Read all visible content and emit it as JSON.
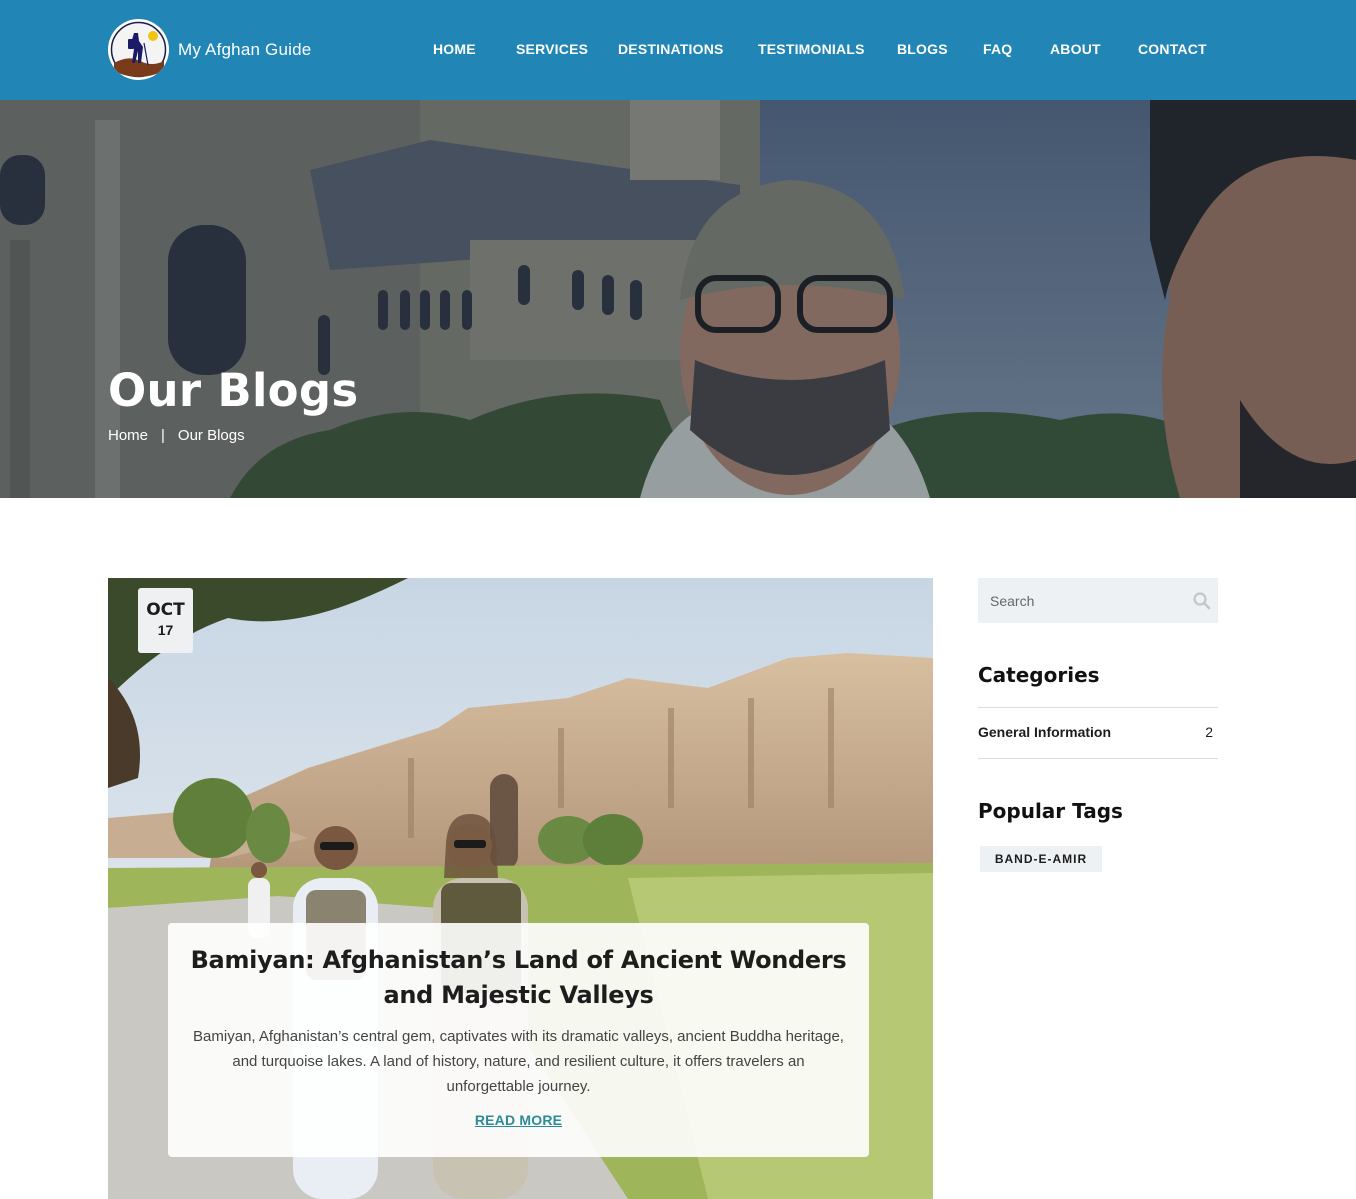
{
  "header": {
    "brand_name": "My Afghan Guide",
    "nav": [
      {
        "label": "HOME"
      },
      {
        "label": "SERVICES"
      },
      {
        "label": "DESTINATIONS"
      },
      {
        "label": "TESTIMONIALS"
      },
      {
        "label": "BLOGS"
      },
      {
        "label": "FAQ"
      },
      {
        "label": "ABOUT"
      },
      {
        "label": "CONTACT"
      }
    ]
  },
  "hero": {
    "title": "Our Blogs",
    "breadcrumb": {
      "home": "Home",
      "separator": "|",
      "current": "Our Blogs"
    }
  },
  "post": {
    "date_month": "OCT",
    "date_day": "17",
    "title": "Bamiyan: Afghanistan’s Land of Ancient Wonders and Majestic Valleys",
    "excerpt": "Bamiyan, Afghanistan’s central gem, captivates with its dramatic valleys, ancient Buddha heritage, and turquoise lakes. A land of history, nature, and resilient culture, it offers travelers an unforgettable journey.",
    "read_more": "READ MORE"
  },
  "sidebar": {
    "search_placeholder": "Search",
    "categories_heading": "Categories",
    "categories": [
      {
        "name": "General Information",
        "count": "2"
      }
    ],
    "tags_heading": "Popular Tags",
    "tags": [
      "BAND-E-AMIR"
    ]
  },
  "colors": {
    "header_bg": "#2185b5",
    "link_accent": "#2a8c96",
    "widget_bg": "#eef1f3"
  },
  "icons": [
    "logo-icon",
    "search-icon"
  ]
}
